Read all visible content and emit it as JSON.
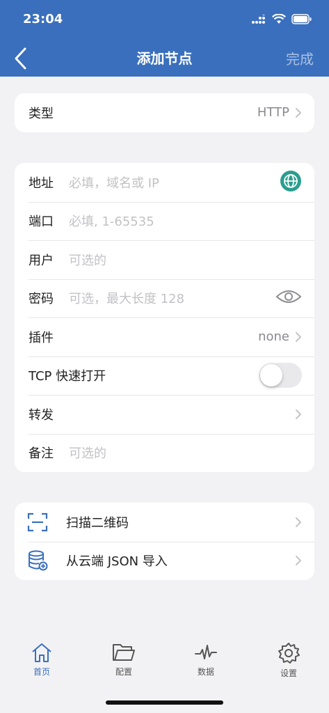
{
  "status_bar": {
    "time": "23:04"
  },
  "navbar": {
    "title": "添加节点",
    "done_label": "完成"
  },
  "type_row": {
    "label": "类型",
    "value": "HTTP"
  },
  "form": {
    "address": {
      "label": "地址",
      "placeholder": "必填，域名或 IP"
    },
    "port": {
      "label": "端口",
      "placeholder": "必填, 1-65535"
    },
    "user": {
      "label": "用户",
      "placeholder": "可选的"
    },
    "password": {
      "label": "密码",
      "placeholder": "可选，最大长度 128"
    },
    "plugin": {
      "label": "插件",
      "value": "none"
    },
    "tcp_fast_open": {
      "label": "TCP 快速打开",
      "enabled": false
    },
    "forward": {
      "label": "转发"
    },
    "note": {
      "label": "备注",
      "placeholder": "可选的"
    }
  },
  "actions": {
    "scan_qr": {
      "label": "扫描二维码"
    },
    "import_json": {
      "label": "从云端 JSON 导入"
    }
  },
  "tabbar": {
    "items": [
      {
        "label": "首页",
        "icon": "home-icon",
        "active": true
      },
      {
        "label": "配置",
        "icon": "folder-icon",
        "active": false
      },
      {
        "label": "数据",
        "icon": "activity-icon",
        "active": false
      },
      {
        "label": "设置",
        "icon": "gear-icon",
        "active": false
      }
    ]
  },
  "colors": {
    "accent": "#3a6fbd",
    "globe": "#2a9d8f"
  }
}
